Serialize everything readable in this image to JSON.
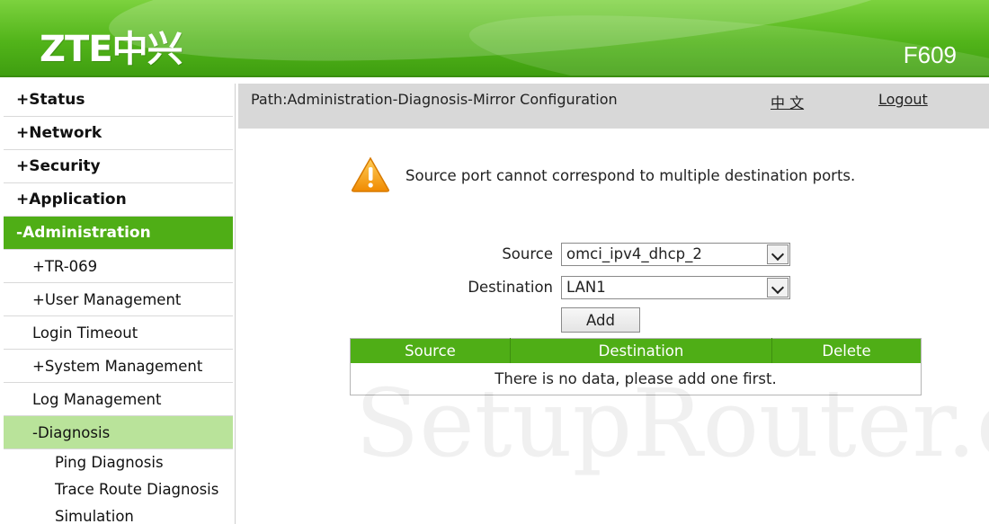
{
  "header": {
    "logo": "ZTE中兴",
    "model": "F609",
    "colors": {
      "brand_green": "#4fae16",
      "active_sub": "#b9e39a"
    }
  },
  "sidebar": {
    "items": [
      {
        "pm": "+",
        "label": "Status"
      },
      {
        "pm": "+",
        "label": "Network"
      },
      {
        "pm": "+",
        "label": "Security"
      },
      {
        "pm": "+",
        "label": "Application"
      },
      {
        "pm": "-",
        "label": "Administration"
      }
    ],
    "admin_sub": [
      {
        "pm": "+",
        "label": "TR-069"
      },
      {
        "pm": "+",
        "label": "User Management"
      },
      {
        "pm": "",
        "label": "Login Timeout"
      },
      {
        "pm": "+",
        "label": "System Management"
      },
      {
        "pm": "",
        "label": "Log Management"
      },
      {
        "pm": "-",
        "label": "Diagnosis"
      }
    ],
    "diagnosis_sub": [
      {
        "label": "Ping Diagnosis"
      },
      {
        "label": "Trace Route Diagnosis"
      },
      {
        "label": "Simulation"
      }
    ]
  },
  "pathbar": {
    "path": "Path:Administration-Diagnosis-Mirror Configuration",
    "lang": "中 文",
    "logout": "Logout"
  },
  "warning": {
    "icon": "warning-triangle-icon",
    "text": "Source port cannot correspond to multiple destination ports."
  },
  "form": {
    "source_label": "Source",
    "source_value": "omci_ipv4_dhcp_2",
    "destination_label": "Destination",
    "destination_value": "LAN1",
    "add_label": "Add"
  },
  "table": {
    "headers": [
      "Source",
      "Destination",
      "Delete"
    ],
    "empty_text": "There is no data, please add one first."
  },
  "watermark": "SetupRouter.com"
}
